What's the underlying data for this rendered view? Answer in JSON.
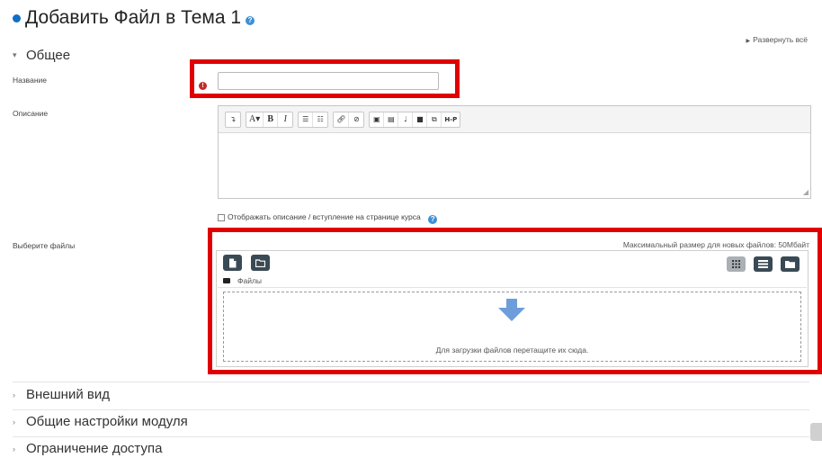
{
  "page": {
    "title": "Добавить Файл в Тема 1",
    "expand_all": "Развернуть всё"
  },
  "general": {
    "header": "Общее",
    "name_label": "Название",
    "name_value": "",
    "description_label": "Описание",
    "editor_toolbar": [
      [
        "collapse"
      ],
      [
        "font-size",
        "bold",
        "italic"
      ],
      [
        "bullet-list",
        "numbered-list"
      ],
      [
        "link",
        "unlink"
      ],
      [
        "image",
        "media",
        "record-audio",
        "record-video",
        "manage-files",
        "h5p"
      ]
    ],
    "editor_labels": {
      "font": "A▾",
      "bold": "B",
      "italic": "I",
      "h5p": "H-P"
    },
    "show_description_label": "Отображать описание / вступление на странице курса"
  },
  "files": {
    "label": "Выберите файлы",
    "max_size": "Максимальный размер для новых файлов: 50Мбайт",
    "path": "Файлы",
    "drop_text": "Для загрузки файлов перетащите их сюда.",
    "accent_color": "#6d9edb"
  },
  "sections": [
    {
      "label": "Внешний вид"
    },
    {
      "label": "Общие настройки модуля"
    },
    {
      "label": "Ограничение доступа"
    }
  ],
  "colors": {
    "highlight": "#e00000",
    "dark_button": "#3a4a55",
    "required": "#c12b2b"
  }
}
